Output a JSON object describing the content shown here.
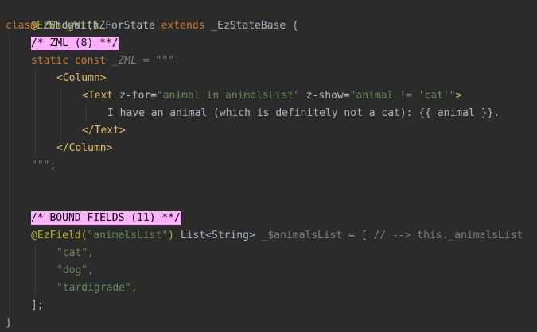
{
  "editor": {
    "annotation_widget": "@EzWidget()",
    "class_kw": "class",
    "class_name": "ZShowWithZForState",
    "extends_kw": "extends",
    "base_class": "_EzStateBase",
    "open_brace": "{",
    "zml_comment": "/* ZML (8) **/",
    "static_kw": "static",
    "const_kw": "const",
    "zml_var": "_ZML",
    "assign_triple": " = \"\"\"",
    "column_open": "<Column>",
    "text_open_tag": "<Text",
    "zfor_attr": "z-for=",
    "zfor_value": "\"animal in animalsList\"",
    "zshow_attr": "z-show=",
    "zshow_value": "\"animal != 'cat'\"",
    "tag_close": ">",
    "text_content": "I have an animal (which is definitely not a cat): {{ animal }}.",
    "text_close": "</Text>",
    "column_close": "</Column>",
    "triple_end": "\"\"\";",
    "bound_comment": "/* BOUND FIELDS (11) **/",
    "ezfield_ann": "@EzField(",
    "ezfield_arg": "\"animalsList\"",
    "ezfield_paren": ")",
    "list_type": " List<String> ",
    "field_name": "_$animalsList",
    "field_assign": " = [ ",
    "field_comment": "// --> this._animalsList",
    "item_cat": "\"cat\"",
    "item_dog": "\"dog\"",
    "item_tardigrade": "\"tardigrade\"",
    "comma": ",",
    "list_close": "];",
    "close_brace": "}"
  }
}
